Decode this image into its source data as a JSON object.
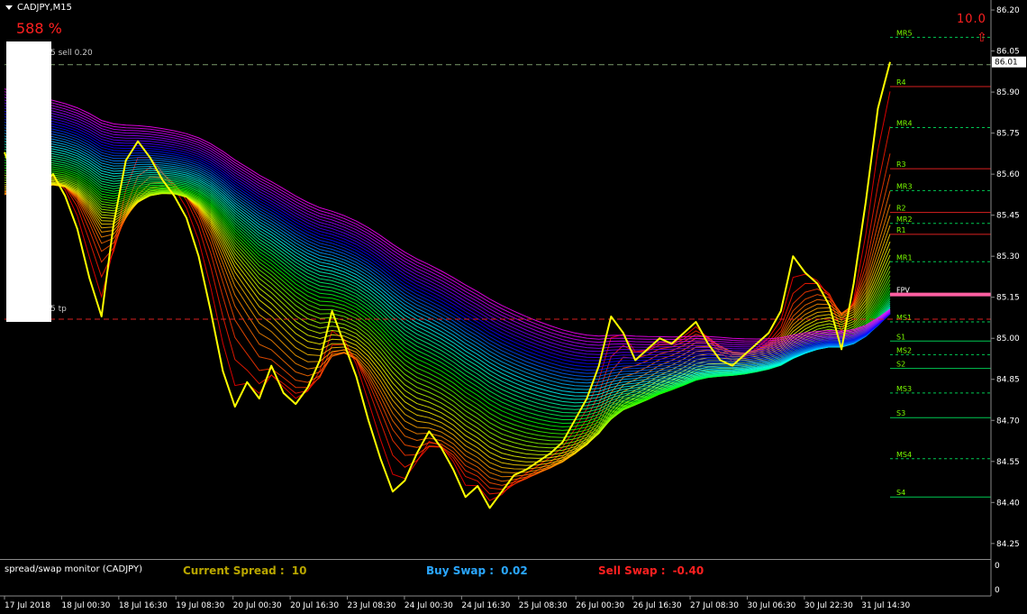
{
  "header": {
    "symbol": "CADJPY,M15",
    "percent": "588 %",
    "sell_order": "5 sell 0.20",
    "tp_label": "5 tp",
    "counter": "10.0",
    "arrow_icon": "up-arrow-icon",
    "arrow_glyph": "⇧"
  },
  "sub_panel": {
    "title": "spread/swap monitor (CADJPY)",
    "spread_label": "Current Spread :",
    "spread_value": "10",
    "buy_swap_label": "Buy Swap :",
    "buy_swap_value": "0.02",
    "sell_swap_label": "Sell Swap :",
    "sell_swap_value": "-0.40",
    "scale_top": "0",
    "scale_bottom": "0"
  },
  "chart_data": {
    "type": "line",
    "symbol": "CADJPY",
    "timeframe": "M15",
    "y_ticks": [
      "86.20",
      "86.05",
      "85.90",
      "85.75",
      "85.60",
      "85.45",
      "85.30",
      "85.15",
      "85.00",
      "84.85",
      "84.70",
      "84.55",
      "84.40",
      "84.25"
    ],
    "ylim": [
      84.2,
      86.22
    ],
    "current_price": "86.01",
    "x_ticks": [
      "17 Jul 2018",
      "18 Jul 00:30",
      "18 Jul 16:30",
      "19 Jul 08:30",
      "20 Jul 00:30",
      "20 Jul 16:30",
      "23 Jul 08:30",
      "24 Jul 00:30",
      "24 Jul 16:30",
      "25 Jul 08:30",
      "26 Jul 00:30",
      "26 Jul 16:30",
      "27 Jul 08:30",
      "30 Jul 06:30",
      "30 Jul 22:30",
      "31 Jul 14:30"
    ],
    "price_series": {
      "name": "",
      "color": "#ffff00",
      "values": [
        85.68,
        85.56,
        85.62,
        85.55,
        85.6,
        85.52,
        85.4,
        85.22,
        85.08,
        85.42,
        85.65,
        85.72,
        85.66,
        85.58,
        85.52,
        85.44,
        85.3,
        85.1,
        84.88,
        84.75,
        84.84,
        84.78,
        84.9,
        84.8,
        84.76,
        84.82,
        84.92,
        85.1,
        84.98,
        84.86,
        84.7,
        84.56,
        84.44,
        84.48,
        84.58,
        84.66,
        84.6,
        84.52,
        84.42,
        84.46,
        84.38,
        84.44,
        84.5,
        84.52,
        84.55,
        84.58,
        84.62,
        84.7,
        84.78,
        84.9,
        85.08,
        85.02,
        84.92,
        84.96,
        85.0,
        84.98,
        85.02,
        85.06,
        84.98,
        84.92,
        84.9,
        84.94,
        84.98,
        85.02,
        85.1,
        85.3,
        85.24,
        85.2,
        85.12,
        84.96,
        85.2,
        85.5,
        85.84,
        86.01
      ]
    },
    "levels": [
      {
        "name": "MR5",
        "value": 86.1,
        "color": "#00c853",
        "style": "dashed"
      },
      {
        "name": "R4",
        "value": 85.92,
        "color": "#d92020",
        "style": "solid"
      },
      {
        "name": "MR4",
        "value": 85.77,
        "color": "#00c853",
        "style": "dashed"
      },
      {
        "name": "R3",
        "value": 85.62,
        "color": "#d92020",
        "style": "solid"
      },
      {
        "name": "MR3",
        "value": 85.54,
        "color": "#00c853",
        "style": "dashed"
      },
      {
        "name": "R2",
        "value": 85.46,
        "color": "#d92020",
        "style": "solid"
      },
      {
        "name": "MR2",
        "value": 85.42,
        "color": "#00c853",
        "style": "dashed"
      },
      {
        "name": "R1",
        "value": 85.38,
        "color": "#d92020",
        "style": "solid"
      },
      {
        "name": "MR1",
        "value": 85.28,
        "color": "#00c853",
        "style": "dashed"
      },
      {
        "name": "FPV",
        "value": 85.16,
        "color": "#ff5fa2",
        "style": "thick"
      },
      {
        "name": "MS1",
        "value": 85.06,
        "color": "#00c853",
        "style": "dashed"
      },
      {
        "name": "S1",
        "value": 84.99,
        "color": "#00c853",
        "style": "solid"
      },
      {
        "name": "MS2",
        "value": 84.94,
        "color": "#00c853",
        "style": "dashed"
      },
      {
        "name": "S2",
        "value": 84.89,
        "color": "#00c853",
        "style": "solid"
      },
      {
        "name": "MS3",
        "value": 84.8,
        "color": "#00c853",
        "style": "dashed"
      },
      {
        "name": "S3",
        "value": 84.71,
        "color": "#00c853",
        "style": "solid"
      },
      {
        "name": "MS4",
        "value": 84.56,
        "color": "#00c853",
        "style": "dashed"
      },
      {
        "name": "S4",
        "value": 84.42,
        "color": "#00c853",
        "style": "solid"
      }
    ],
    "order_lines": [
      {
        "label": "5 sell 0.20",
        "value": 86.0,
        "color": "#7a9a6a",
        "style": "dashed"
      },
      {
        "label": "5 tp",
        "value": 85.07,
        "color": "#d92020",
        "style": "dashed"
      }
    ],
    "ma_ribbon": {
      "color_start": "#ff0000",
      "color_end": "#ff00ff",
      "count": 48
    }
  }
}
